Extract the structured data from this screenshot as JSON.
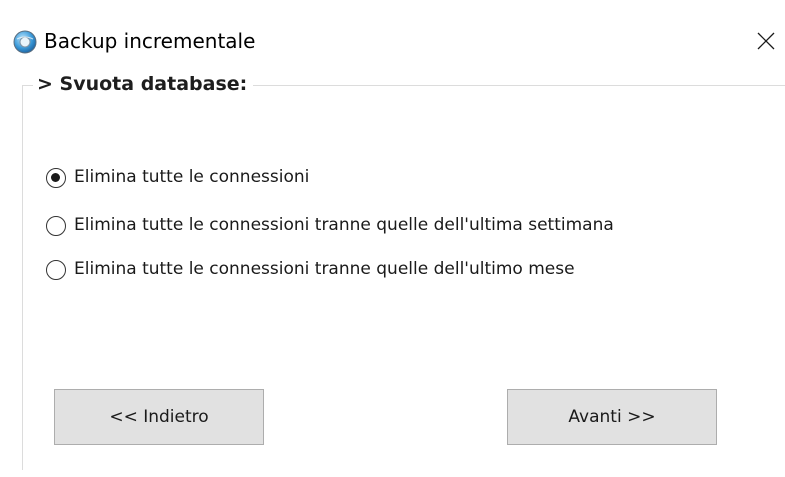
{
  "window": {
    "title": "Backup incrementale",
    "app_icon": "globe-backup-icon",
    "close_icon": "close-icon"
  },
  "group": {
    "label": "> Svuota database:"
  },
  "options": [
    {
      "label": "Elimina tutte le connessioni",
      "selected": true
    },
    {
      "label": "Elimina tutte le connessioni tranne quelle dell'ultima settimana",
      "selected": false
    },
    {
      "label": "Elimina tutte le connessioni tranne quelle dell'ultimo mese",
      "selected": false
    }
  ],
  "buttons": {
    "back_label": "<< Indietro",
    "next_label": "Avanti >>"
  },
  "colors": {
    "button_bg": "#e1e1e1",
    "button_border": "#adadad",
    "groupbox_border": "#dcdcdc"
  }
}
